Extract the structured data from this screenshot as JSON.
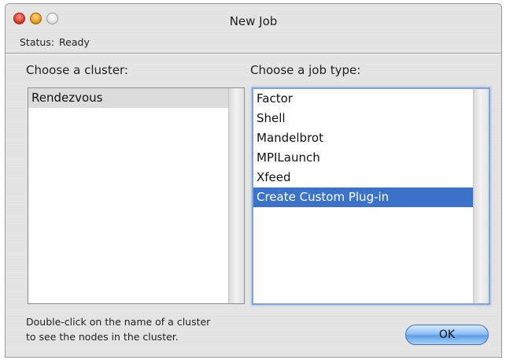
{
  "window": {
    "title": "New Job",
    "status_label": "Status:",
    "status_value": "Ready"
  },
  "cluster_panel": {
    "label": "Choose a cluster:",
    "items": [
      "Rendezvous"
    ]
  },
  "job_panel": {
    "label": "Choose a job type:",
    "items": [
      "Factor",
      "Shell",
      "Mandelbrot",
      "MPILaunch",
      "Xfeed",
      "Create Custom Plug-in"
    ],
    "selected": "Create Custom Plug-in"
  },
  "hint": {
    "line1": "Double-click on the name of a cluster",
    "line2": "to see the nodes in the cluster."
  },
  "buttons": {
    "ok": "OK"
  },
  "colors": {
    "selection": "#3a73c9",
    "focus_ring": "#7ea4d8"
  }
}
